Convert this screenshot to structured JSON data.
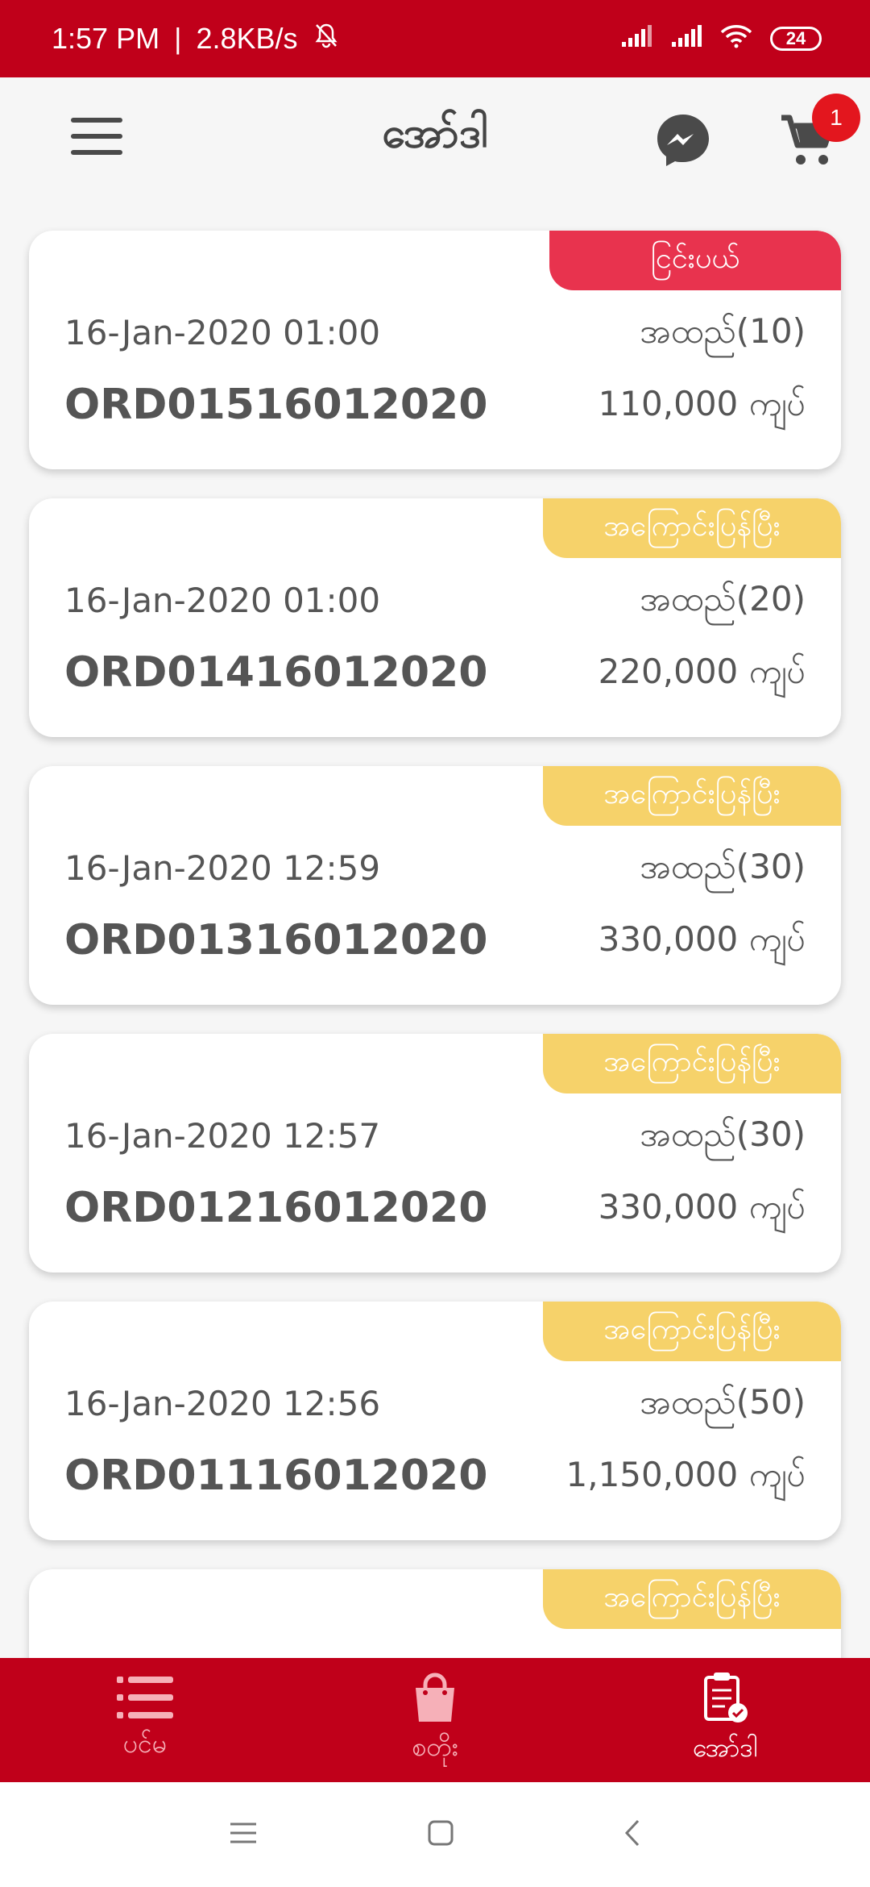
{
  "status_bar": {
    "time": "1:57 PM",
    "speed": "2.8KB/s",
    "battery": "24",
    "icons": [
      "mute-bell-icon",
      "signal-icon",
      "signal-icon",
      "wifi-icon",
      "battery-icon"
    ]
  },
  "header": {
    "title": "အော်ဒါ",
    "cart_badge": "1",
    "icons": [
      "menu-icon",
      "messenger-icon",
      "cart-icon"
    ]
  },
  "orders": [
    {
      "tag": "ငြင်းပယ်",
      "tag_type": "cancel",
      "date": "16-Jan-2020 01:00",
      "code": "ORD01516012020",
      "qty": "အထည်(10)",
      "amount": "110,000 ကျပ်"
    },
    {
      "tag": "အကြောင်းပြန်ပြီး",
      "tag_type": "done",
      "date": "16-Jan-2020 01:00",
      "code": "ORD01416012020",
      "qty": "အထည်(20)",
      "amount": "220,000 ကျပ်"
    },
    {
      "tag": "အကြောင်းပြန်ပြီး",
      "tag_type": "done",
      "date": "16-Jan-2020 12:59",
      "code": "ORD01316012020",
      "qty": "အထည်(30)",
      "amount": "330,000 ကျပ်"
    },
    {
      "tag": "အကြောင်းပြန်ပြီး",
      "tag_type": "done",
      "date": "16-Jan-2020 12:57",
      "code": "ORD01216012020",
      "qty": "အထည်(30)",
      "amount": "330,000 ကျပ်"
    },
    {
      "tag": "အကြောင်းပြန်ပြီး",
      "tag_type": "done",
      "date": "16-Jan-2020 12:56",
      "code": "ORD01116012020",
      "qty": "အထည်(50)",
      "amount": "1,150,000 ကျပ်"
    },
    {
      "tag": "အကြောင်းပြန်ပြီး",
      "tag_type": "done",
      "date": "",
      "code": "",
      "qty": "",
      "amount": ""
    }
  ],
  "bottom_nav": {
    "items": [
      {
        "label": "ပင်မ",
        "icon": "list-icon"
      },
      {
        "label": "စတိုး",
        "icon": "shopping-bag-icon"
      },
      {
        "label": "အော်ဒါ",
        "icon": "clipboard-check-icon",
        "active": true
      }
    ]
  },
  "colors": {
    "brand": "#c0001a",
    "cancel_tag": "#e8334e",
    "done_tag": "#f6d26a"
  }
}
